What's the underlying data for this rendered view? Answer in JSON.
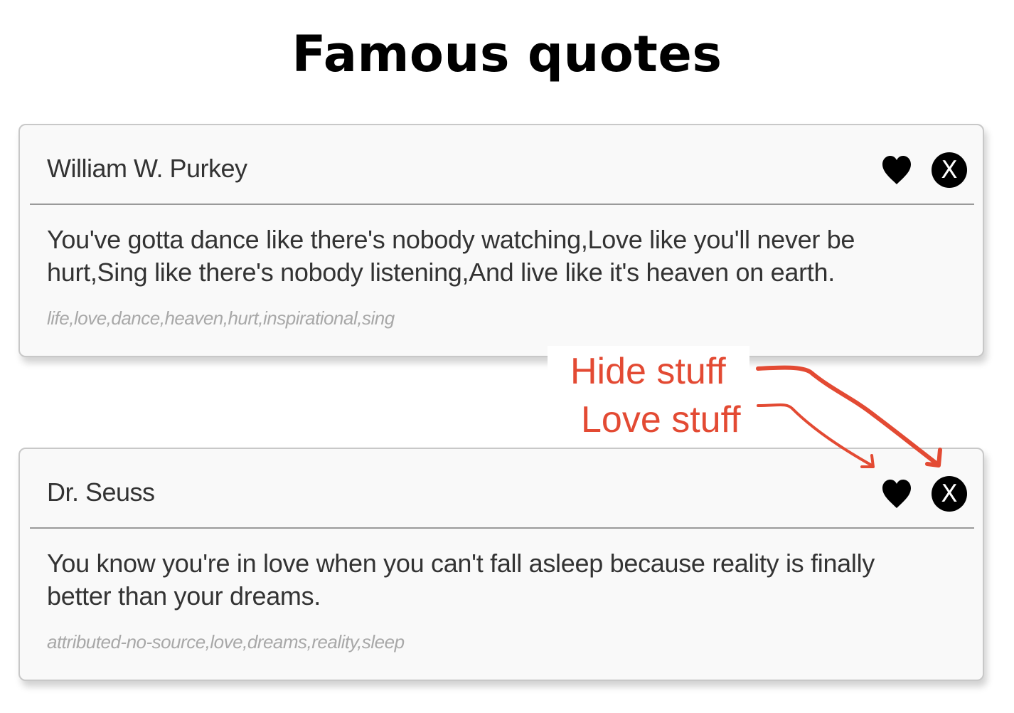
{
  "page": {
    "title": "Famous quotes"
  },
  "quotes": [
    {
      "author": "William W. Purkey",
      "text": "You've gotta dance like there's nobody watching,Love like you'll never be hurt,Sing like there's nobody listening,And live like it's heaven on earth.",
      "tags": "life,love,dance,heaven,hurt,inspirational,sing",
      "love_icon": "heart-icon",
      "hide_label": "X"
    },
    {
      "author": "Dr. Seuss",
      "text": "You know you're in love when you can't fall asleep because reality is finally better than your dreams.",
      "tags": "attributed-no-source,love,dreams,reality,sleep",
      "love_icon": "heart-icon",
      "hide_label": "X"
    }
  ],
  "annotations": {
    "hide": "Hide stuff",
    "love": "Love stuff",
    "color": "#e34a33"
  },
  "colors": {
    "card_background": "#f9f9f9",
    "card_border": "#c8c8c8",
    "tag_text": "#a8a8a8",
    "icon": "#000000"
  }
}
